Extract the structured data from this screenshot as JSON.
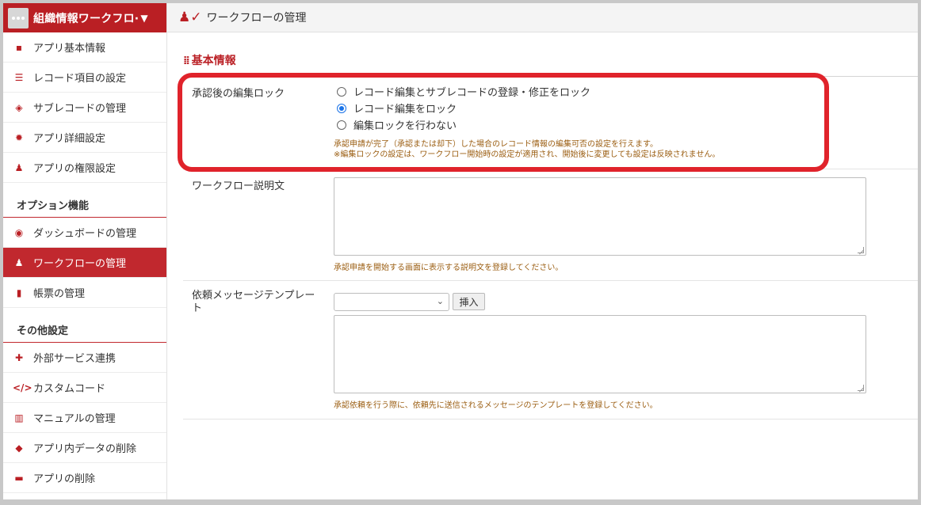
{
  "app": {
    "title": "組織情報ワークフロ·"
  },
  "sidebar": {
    "items": [
      {
        "label": "アプリ基本情報",
        "icon": "info-icon"
      },
      {
        "label": "レコード項目の設定",
        "icon": "list-icon"
      },
      {
        "label": "サブレコードの管理",
        "icon": "layers-icon"
      },
      {
        "label": "アプリ詳細設定",
        "icon": "gear-icon"
      },
      {
        "label": "アプリの権限設定",
        "icon": "user-lock-icon"
      }
    ],
    "option_title": "オプション機能",
    "option_items": [
      {
        "label": "ダッシュボードの管理",
        "icon": "dashboard-icon"
      },
      {
        "label": "ワークフローの管理",
        "icon": "user-check-icon",
        "active": true
      },
      {
        "label": "帳票の管理",
        "icon": "file-excel-icon"
      }
    ],
    "other_title": "その他設定",
    "other_items": [
      {
        "label": "外部サービス連携",
        "icon": "puzzle-icon"
      },
      {
        "label": "カスタムコード",
        "icon": "code-icon"
      },
      {
        "label": "マニュアルの管理",
        "icon": "book-icon"
      },
      {
        "label": "アプリ内データの削除",
        "icon": "eraser-icon"
      },
      {
        "label": "アプリの削除",
        "icon": "trash-icon"
      }
    ]
  },
  "topbar": {
    "title": "ワークフローの管理"
  },
  "main": {
    "section_title": "基本情報",
    "lock": {
      "label": "承認後の編集ロック",
      "options": [
        "レコード編集とサブレコードの登録・修正をロック",
        "レコード編集をロック",
        "編集ロックを行わない"
      ],
      "selected_index": 1,
      "help_1": "承認申請が完了（承認または却下）した場合のレコード情報の編集可否の設定を行えます。",
      "help_2": "※編集ロックの設定は、ワークフロー開始時の設定が適用され、開始後に変更しても設定は反映されません。"
    },
    "description": {
      "label": "ワークフロー説明文",
      "value": "",
      "help": "承認申請を開始する画面に表示する説明文を登録してください。"
    },
    "template": {
      "label_1": "依頼メッセージテンプレー",
      "label_2": "ト",
      "select_value": "",
      "insert_label": "挿入",
      "value": "",
      "help": "承認依頼を行う際に、依頼先に送信されるメッセージのテンプレートを登録してください。"
    }
  },
  "colors": {
    "brand": "#ba1f24",
    "highlight": "#e0232b",
    "help_text": "#9b5e12",
    "radio_checked": "#1a73e8"
  }
}
